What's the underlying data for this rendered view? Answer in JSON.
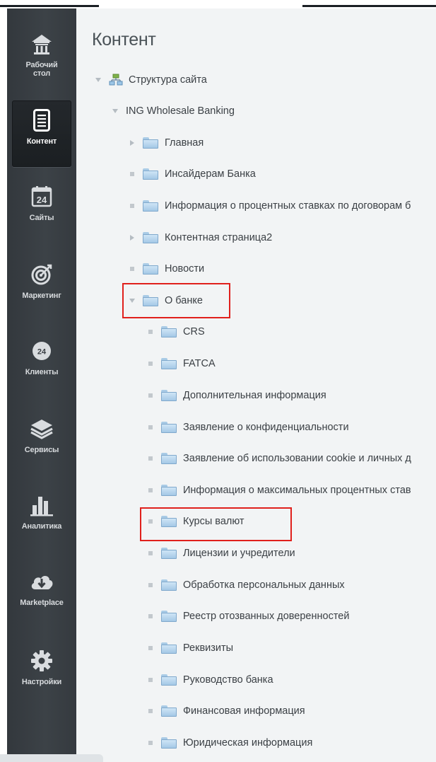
{
  "sidebar": {
    "items": [
      {
        "label": "Рабочий\nстол",
        "icon": "home-icon"
      },
      {
        "label": "Контент",
        "icon": "document-icon",
        "active": true
      },
      {
        "label": "Сайты",
        "icon": "calendar-24-icon"
      },
      {
        "label": "Маркетинг",
        "icon": "target-icon"
      },
      {
        "label": "Клиенты",
        "icon": "clock-24-icon"
      },
      {
        "label": "Сервисы",
        "icon": "layers-icon"
      },
      {
        "label": "Аналитика",
        "icon": "bar-chart-icon"
      },
      {
        "label": "Marketplace",
        "icon": "cloud-download-icon"
      },
      {
        "label": "Настройки",
        "icon": "gear-icon"
      }
    ]
  },
  "content": {
    "title": "Контент",
    "tree": [
      {
        "label": "Структура сайта",
        "toggle": "expanded",
        "icon": "site-structure-icon"
      },
      {
        "label": "ING Wholesale Banking",
        "toggle": "expanded",
        "icon": ""
      },
      {
        "label": "Главная",
        "toggle": "collapsed",
        "icon": "folder-icon"
      },
      {
        "label": "Инсайдерам Банка",
        "toggle": "leaf",
        "icon": "folder-icon"
      },
      {
        "label": "Информация о процентных ставках по договорам б",
        "toggle": "leaf",
        "icon": "folder-icon"
      },
      {
        "label": "Контентная страница2",
        "toggle": "collapsed",
        "icon": "folder-icon"
      },
      {
        "label": "Новости",
        "toggle": "leaf",
        "icon": "folder-icon"
      },
      {
        "label": "О банке",
        "toggle": "expanded",
        "icon": "folder-icon",
        "highlighted": true
      },
      {
        "label": "CRS",
        "toggle": "leaf",
        "icon": "folder-icon"
      },
      {
        "label": "FATCA",
        "toggle": "leaf",
        "icon": "folder-icon"
      },
      {
        "label": "Дополнительная информация",
        "toggle": "leaf",
        "icon": "folder-icon"
      },
      {
        "label": "Заявление о конфиденциальности",
        "toggle": "leaf",
        "icon": "folder-icon"
      },
      {
        "label": "Заявление об использовании cookie и личных д",
        "toggle": "leaf",
        "icon": "folder-icon"
      },
      {
        "label": "Информация о максимальных процентных став",
        "toggle": "leaf",
        "icon": "folder-icon"
      },
      {
        "label": "Курсы валют",
        "toggle": "leaf",
        "icon": "folder-icon",
        "highlighted": true
      },
      {
        "label": "Лицензии и учредители",
        "toggle": "leaf",
        "icon": "folder-icon"
      },
      {
        "label": "Обработка персональных данных",
        "toggle": "leaf",
        "icon": "folder-icon"
      },
      {
        "label": "Реестр отозванных доверенностей",
        "toggle": "leaf",
        "icon": "folder-icon"
      },
      {
        "label": "Реквизиты",
        "toggle": "leaf",
        "icon": "folder-icon"
      },
      {
        "label": "Руководство банка",
        "toggle": "leaf",
        "icon": "folder-icon"
      },
      {
        "label": "Финансовая информация",
        "toggle": "leaf",
        "icon": "folder-icon"
      },
      {
        "label": "Юридическая информация",
        "toggle": "leaf",
        "icon": "folder-icon"
      }
    ]
  },
  "colors": {
    "sidebar_bg": "#3a3f44",
    "content_bg": "#f2f4f5",
    "highlight": "#e0201c",
    "folder": "#a4c8e6"
  }
}
